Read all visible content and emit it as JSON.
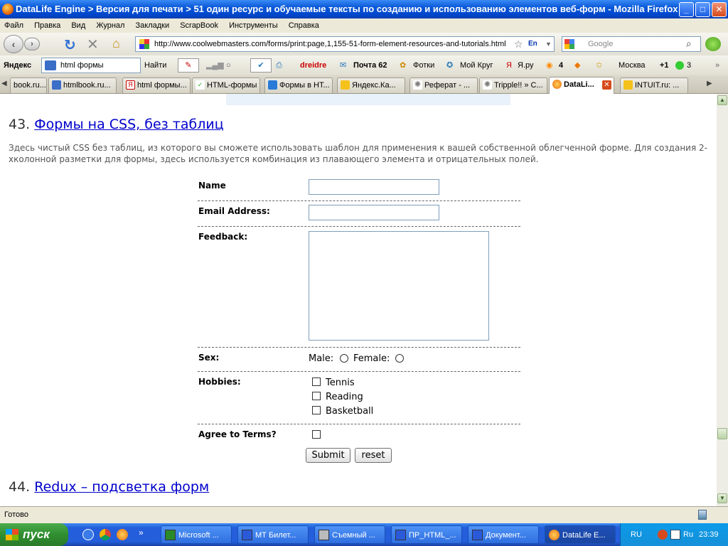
{
  "window": {
    "title": "DataLife Engine > Версия для печати > 51 один ресурс и обучаемые тексты по созданию и использованию элементов веб-форм - Mozilla Firefox",
    "min": "_",
    "max": "□",
    "close": "✕"
  },
  "menu": [
    "Файл",
    "Правка",
    "Вид",
    "Журнал",
    "Закладки",
    "ScrapBook",
    "Инструменты",
    "Справка"
  ],
  "nav": {
    "url": "http://www.coolwebmasters.com/forms/print:page,1,155-51-form-element-resources-and-tutorials.html",
    "search_placeholder": "Google",
    "lang": "En"
  },
  "yandex": {
    "logo": "Яндекс",
    "search_value": "html формы",
    "find": "Найти",
    "user": "dreidre",
    "mail": "Почта 62",
    "photos": "Фотки",
    "circle": "Мой Круг",
    "yaru": "Я.ру",
    "rss_count": "4",
    "city": "Москва",
    "temp": "+1",
    "count3": "3"
  },
  "tabs": [
    {
      "label": "book.ru..."
    },
    {
      "label": "htmlbook.ru..."
    },
    {
      "label": "html формы..."
    },
    {
      "label": "HTML-формы"
    },
    {
      "label": "Формы в HT..."
    },
    {
      "label": "Яндекс.Ка..."
    },
    {
      "label": "Реферат - ..."
    },
    {
      "label": "Tripple!! » C..."
    },
    {
      "label": "DataLi..."
    },
    {
      "label": "INTUIT.ru: ..."
    }
  ],
  "article": {
    "item43_num": "43.",
    "item43_title": "Формы на CSS, без таблиц",
    "item43_desc": "Здесь чистый CSS без таблиц, из которого вы сможете использовать шаблон для применения к вашей собственной облегченной форме. Для создания 2-хколонной разметки для формы, здесь используется комбинация из плавающего элемента и отрицательных полей.",
    "item44_num": "44.",
    "item44_title": "Redux – подсветка форм"
  },
  "form": {
    "name_label": "Name",
    "email_label": "Email Address:",
    "feedback_label": "Feedback:",
    "sex_label": "Sex:",
    "male": "Male:",
    "female": "Female:",
    "hobbies_label": "Hobbies:",
    "hobbies": [
      "Tennis",
      "Reading",
      "Basketball"
    ],
    "terms_label": "Agree to Terms?",
    "submit": "Submit",
    "reset": "reset"
  },
  "status": "Готово",
  "taskbar": {
    "start": "пуск",
    "tasks": [
      "Microsoft ...",
      "МТ Билет...",
      "Съемный ...",
      "ПР_HTML_...",
      "Документ...",
      "DataLife E..."
    ],
    "lang": "RU",
    "kbd": "Ru",
    "clock": "23:39"
  },
  "colors": {
    "link": "#0000cc",
    "titlebar": "#0a58d8",
    "taskbar": "#245edb"
  }
}
